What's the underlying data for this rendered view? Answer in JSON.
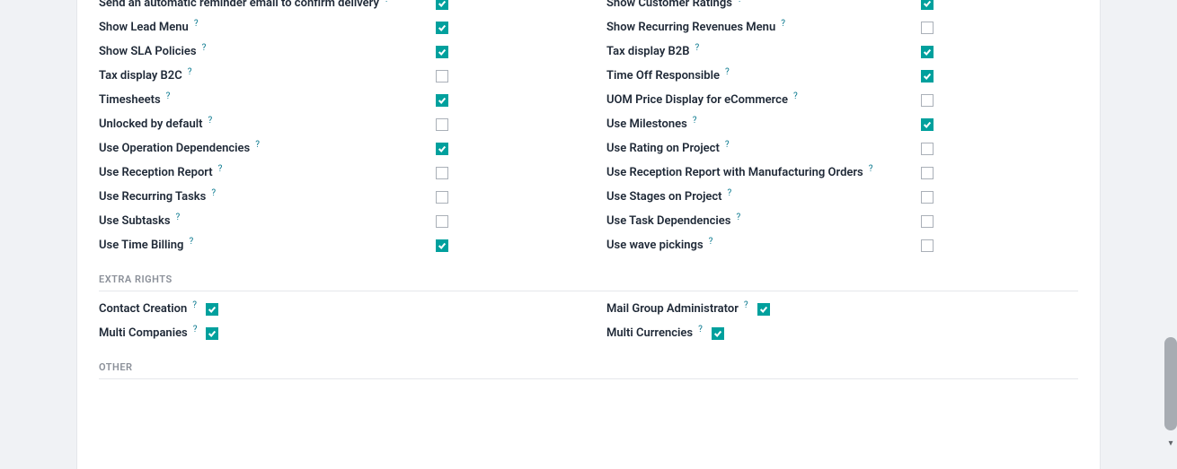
{
  "colors": {
    "accent": "#00a09d"
  },
  "sections": {
    "technical": {
      "left": [
        {
          "label": "Send an automatic reminder email to confirm delivery",
          "checked": true
        },
        {
          "label": "Show Lead Menu",
          "checked": true
        },
        {
          "label": "Show SLA Policies",
          "checked": true
        },
        {
          "label": "Tax display B2C",
          "checked": false
        },
        {
          "label": "Timesheets",
          "checked": true
        },
        {
          "label": "Unlocked by default",
          "checked": false
        },
        {
          "label": "Use Operation Dependencies",
          "checked": true
        },
        {
          "label": "Use Reception Report",
          "checked": false
        },
        {
          "label": "Use Recurring Tasks",
          "checked": false
        },
        {
          "label": "Use Subtasks",
          "checked": false
        },
        {
          "label": "Use Time Billing",
          "checked": true
        }
      ],
      "right": [
        {
          "label": "Show Customer Ratings",
          "checked": true
        },
        {
          "label": "Show Recurring Revenues Menu",
          "checked": false
        },
        {
          "label": "Tax display B2B",
          "checked": true
        },
        {
          "label": "Time Off Responsible",
          "checked": true
        },
        {
          "label": "UOM Price Display for eCommerce",
          "checked": false
        },
        {
          "label": "Use Milestones",
          "checked": true
        },
        {
          "label": "Use Rating on Project",
          "checked": false
        },
        {
          "label": "Use Reception Report with Manufacturing Orders",
          "checked": false
        },
        {
          "label": "Use Stages on Project",
          "checked": false
        },
        {
          "label": "Use Task Dependencies",
          "checked": false
        },
        {
          "label": "Use wave pickings",
          "checked": false
        }
      ]
    },
    "extra_rights": {
      "title": "EXTRA RIGHTS",
      "left": [
        {
          "label": "Contact Creation",
          "checked": true
        },
        {
          "label": "Multi Companies",
          "checked": true
        }
      ],
      "right": [
        {
          "label": "Mail Group Administrator",
          "checked": true
        },
        {
          "label": "Multi Currencies",
          "checked": true
        }
      ]
    },
    "other": {
      "title": "OTHER"
    }
  },
  "help_marker": "?"
}
